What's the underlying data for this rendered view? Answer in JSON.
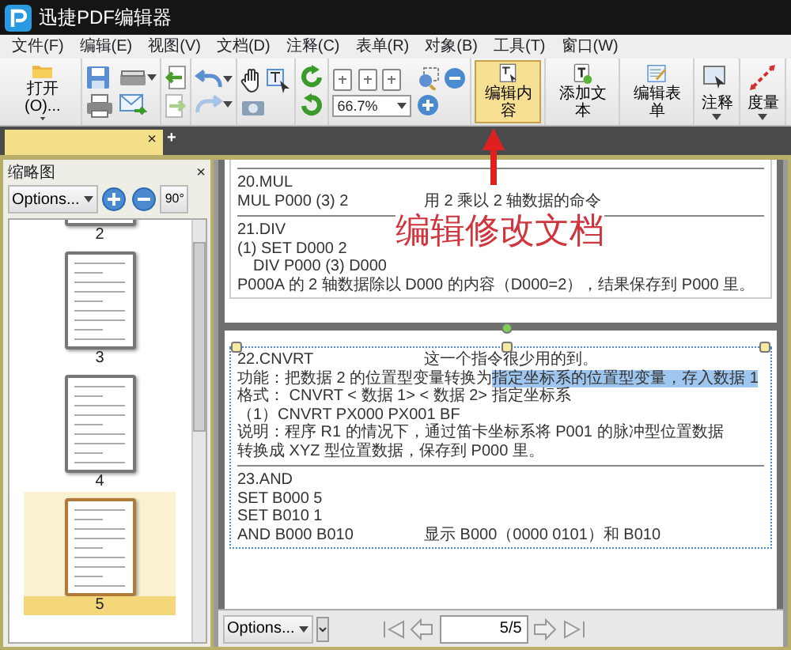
{
  "app": {
    "title": "迅捷PDF编辑器"
  },
  "menu": [
    "文件(F)",
    "编辑(E)",
    "视图(V)",
    "文档(D)",
    "注释(C)",
    "表单(R)",
    "对象(B)",
    "工具(T)",
    "窗口(W)"
  ],
  "toolbar": {
    "open_label": "打开(O)...",
    "zoom": "66.7%",
    "buttons": [
      {
        "label": "编辑内容",
        "selected": true
      },
      {
        "label": "添加文本",
        "selected": false
      },
      {
        "label": "编辑表单",
        "selected": false
      },
      {
        "label": "注释",
        "selected": false
      },
      {
        "label": "度量",
        "selected": false
      }
    ]
  },
  "tab_bar": {
    "close": "×",
    "new_tab": "+"
  },
  "thumbnails": {
    "title": "缩略图",
    "close": "×",
    "options": "Options...",
    "rotate": "90°",
    "pages": [
      {
        "label": "2",
        "selected": false
      },
      {
        "label": "3",
        "selected": false
      },
      {
        "label": "4",
        "selected": false
      },
      {
        "label": "5",
        "selected": true
      }
    ]
  },
  "annotation": {
    "text": "编辑修改文档"
  },
  "pages": [
    {
      "selected": false,
      "lines": [
        {
          "kind": "rule"
        },
        {
          "kind": "text",
          "text": "20.MUL"
        },
        {
          "kind": "text",
          "text": "MUL P000 (3) 2",
          "note": "用 2 乘以 2 轴数据的命令"
        },
        {
          "kind": "rule"
        },
        {
          "kind": "text",
          "text": "21.DIV"
        },
        {
          "kind": "text",
          "text": "(1) SET D000 2"
        },
        {
          "kind": "sub",
          "text": "DIV P000 (3) D000"
        },
        {
          "kind": "text",
          "text": "P000A 的 2 轴数据除以 D000 的内容（D000=2），结果保存到 P000 里。"
        }
      ]
    },
    {
      "selected": true,
      "lines": [
        {
          "kind": "text",
          "text": "22.CNVRT",
          "note": "这一个指令很少用的到。"
        },
        {
          "kind": "text",
          "text": "功能：把数据 2 的位置型变量转换为",
          "highlight": "指定坐标系的位置型变量，存入数据 1"
        },
        {
          "kind": "text",
          "text": "格式：  CNVRT  <  数据  1>  <  数据  2> 指定坐标系"
        },
        {
          "kind": "text",
          "text": "（1）CNVRT PX000 PX001 BF"
        },
        {
          "kind": "text",
          "text": "说明：程序 R1 的情况下，通过笛卡坐标系将 P001 的脉冲型位置数据"
        },
        {
          "kind": "text",
          "text": "转换成 XYZ 型位置数据，保存到 P000 里。"
        },
        {
          "kind": "rule"
        },
        {
          "kind": "text",
          "text": "23.AND"
        },
        {
          "kind": "text",
          "text": "SET B000 5"
        },
        {
          "kind": "text",
          "text": "SET B010 1"
        },
        {
          "kind": "text",
          "text": "AND B000 B010",
          "note": "显示 B000（0000 0101）和 B010"
        }
      ]
    }
  ],
  "bottom_bar": {
    "options": "Options...",
    "page_field": "5/5"
  }
}
